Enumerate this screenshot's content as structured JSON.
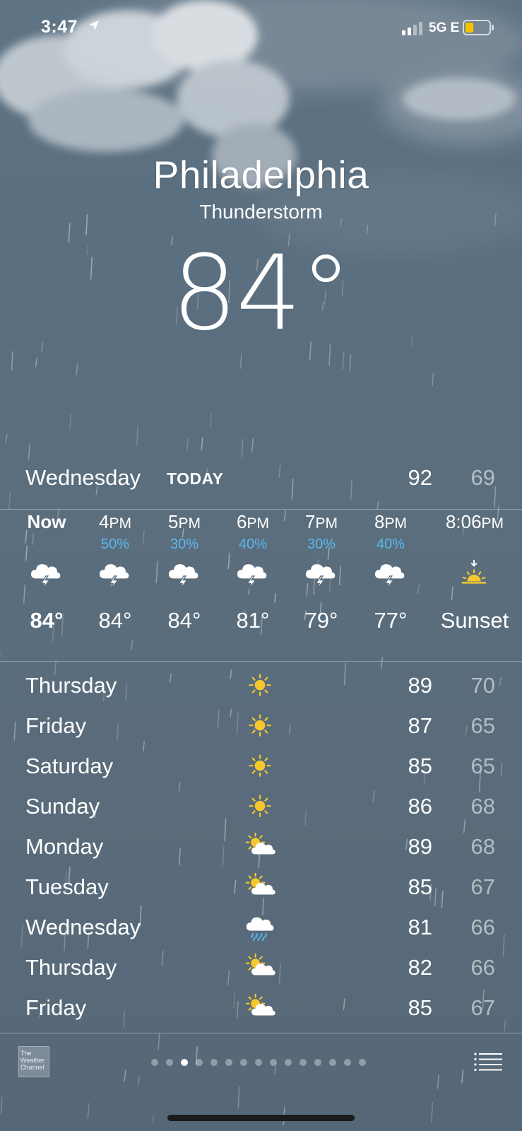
{
  "status_bar": {
    "time": "3:47",
    "network": "5G E",
    "battery_level": 0.35,
    "battery_color": "#f5c400"
  },
  "location": {
    "city": "Philadelphia",
    "condition": "Thunderstorm",
    "temperature": "84°"
  },
  "today": {
    "day": "Wednesday",
    "tag": "TODAY",
    "high": "92",
    "low": "69"
  },
  "hourly": [
    {
      "time": "Now",
      "ampm": "",
      "pop": "",
      "icon": "thunderstorm-icon",
      "temp": "84°",
      "bold": true
    },
    {
      "time": "4",
      "ampm": "PM",
      "pop": "50%",
      "icon": "thunderstorm-icon",
      "temp": "84°",
      "bold": false
    },
    {
      "time": "5",
      "ampm": "PM",
      "pop": "30%",
      "icon": "thunderstorm-icon",
      "temp": "84°",
      "bold": false
    },
    {
      "time": "6",
      "ampm": "PM",
      "pop": "40%",
      "icon": "thunderstorm-icon",
      "temp": "81°",
      "bold": false
    },
    {
      "time": "7",
      "ampm": "PM",
      "pop": "30%",
      "icon": "thunderstorm-icon",
      "temp": "79°",
      "bold": false
    },
    {
      "time": "8",
      "ampm": "PM",
      "pop": "40%",
      "icon": "thunderstorm-icon",
      "temp": "77°",
      "bold": false
    },
    {
      "time": "8:06",
      "ampm": "PM",
      "pop": "",
      "icon": "sunset-icon",
      "temp": "Sunset",
      "bold": false
    }
  ],
  "daily": [
    {
      "day": "Thursday",
      "icon": "sun-icon",
      "high": "89",
      "low": "70"
    },
    {
      "day": "Friday",
      "icon": "sun-icon",
      "high": "87",
      "low": "65"
    },
    {
      "day": "Saturday",
      "icon": "sun-icon",
      "high": "85",
      "low": "65"
    },
    {
      "day": "Sunday",
      "icon": "sun-icon",
      "high": "86",
      "low": "68"
    },
    {
      "day": "Monday",
      "icon": "partly-cloudy-icon",
      "high": "89",
      "low": "68"
    },
    {
      "day": "Tuesday",
      "icon": "partly-cloudy-icon",
      "high": "85",
      "low": "67"
    },
    {
      "day": "Wednesday",
      "icon": "rain-icon",
      "high": "81",
      "low": "66"
    },
    {
      "day": "Thursday",
      "icon": "partly-cloudy-icon",
      "high": "82",
      "low": "66"
    },
    {
      "day": "Friday",
      "icon": "partly-cloudy-icon",
      "high": "85",
      "low": "67"
    }
  ],
  "footer": {
    "logo_text": "The Weather Channel",
    "page_count": 15,
    "active_page": 3
  },
  "colors": {
    "precip_blue": "#5ab8f2",
    "sun_yellow": "#f7c82c"
  }
}
